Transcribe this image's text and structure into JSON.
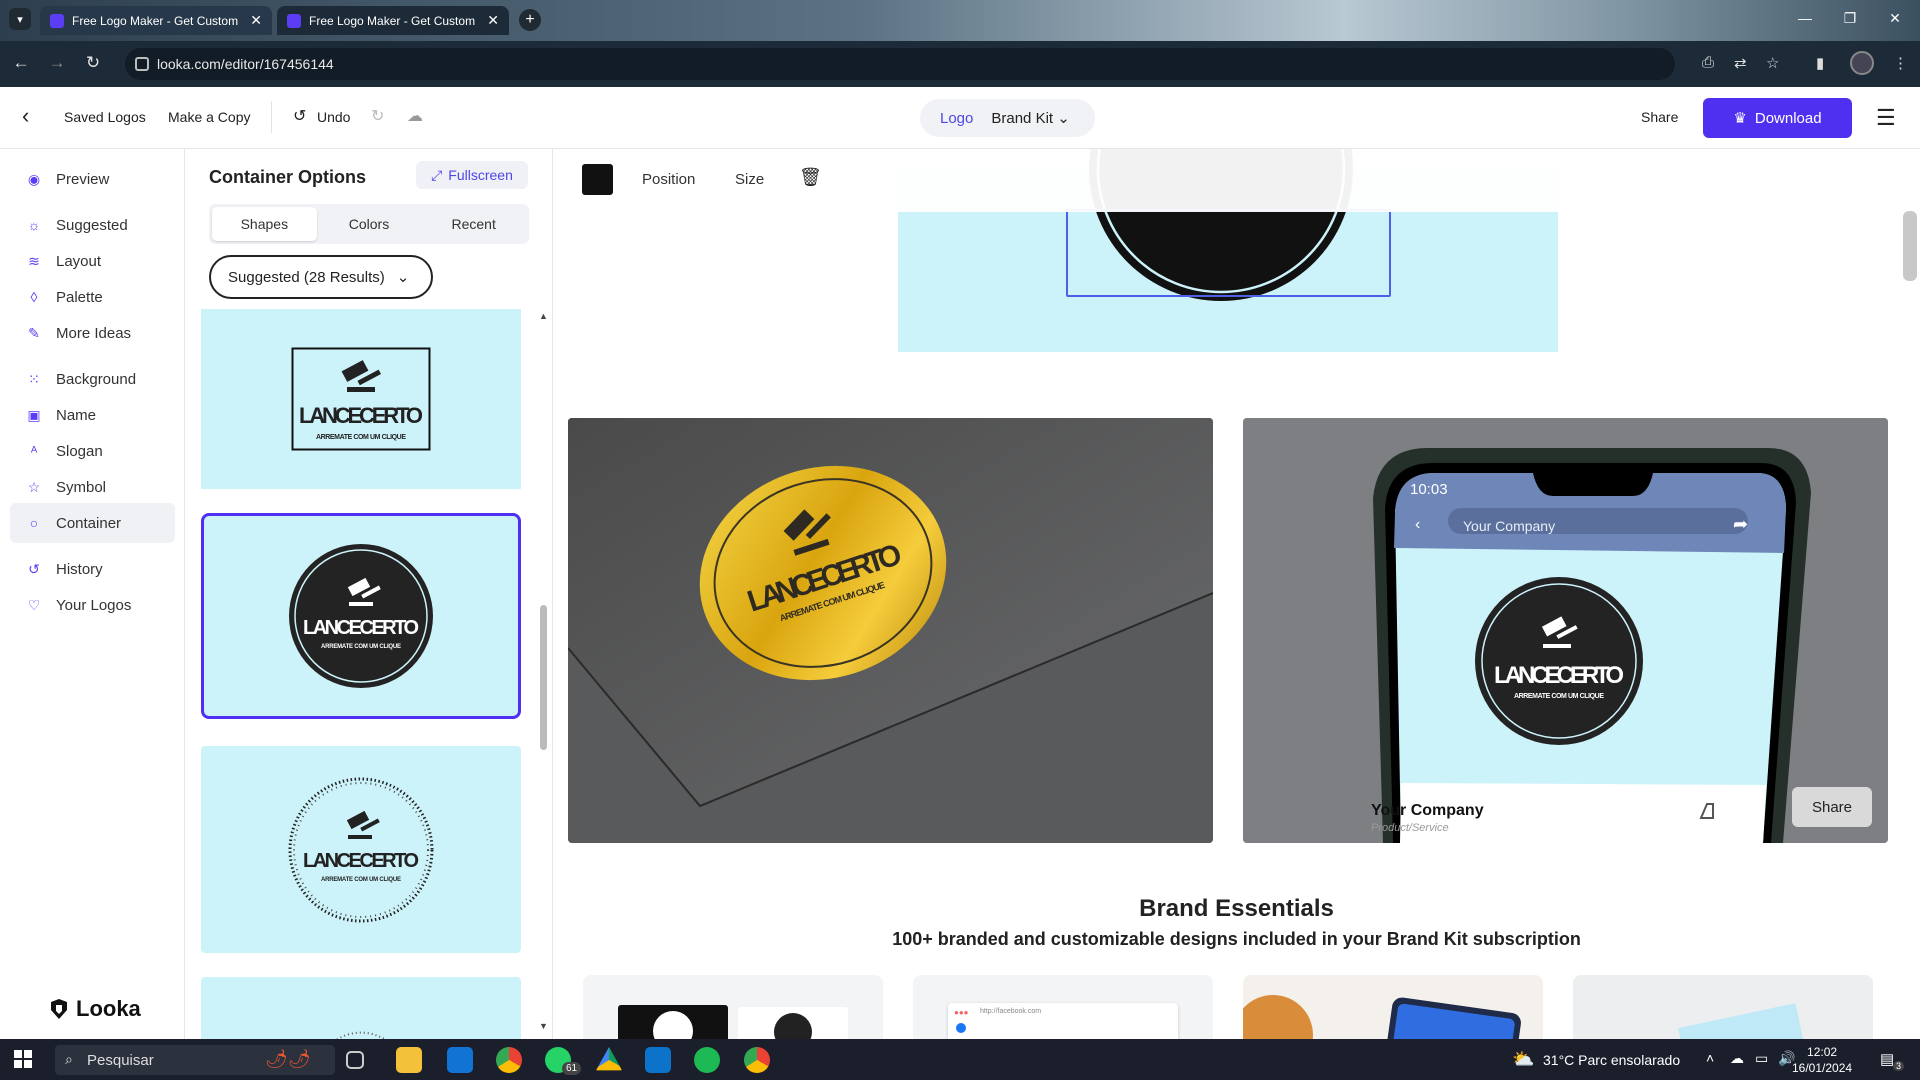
{
  "browser": {
    "tabs": [
      {
        "title": "Free Logo Maker - Get Custom"
      },
      {
        "title": "Free Logo Maker - Get Custom"
      }
    ],
    "url": "looka.com/editor/167456144"
  },
  "header": {
    "saved_logos": "Saved Logos",
    "make_copy": "Make a Copy",
    "undo": "Undo",
    "mode_logo": "Logo",
    "mode_brandkit": "Brand Kit",
    "share": "Share",
    "download": "Download"
  },
  "sidebar": {
    "items": [
      {
        "label": "Preview"
      },
      {
        "label": "Suggested"
      },
      {
        "label": "Layout"
      },
      {
        "label": "Palette"
      },
      {
        "label": "More Ideas"
      },
      {
        "label": "Background"
      },
      {
        "label": "Name"
      },
      {
        "label": "Slogan"
      },
      {
        "label": "Symbol"
      },
      {
        "label": "Container"
      },
      {
        "label": "History"
      },
      {
        "label": "Your Logos"
      }
    ],
    "brand": "Looka"
  },
  "options": {
    "title": "Container Options",
    "fullscreen": "Fullscreen",
    "tabs": [
      "Shapes",
      "Colors",
      "Recent"
    ],
    "dropdown": "Suggested (28 Results)",
    "logo_name": "LANCECERTO",
    "logo_slogan": "ARREMATE COM UM CLIQUE"
  },
  "toolbar": {
    "position": "Position",
    "size": "Size",
    "swatch_color": "#111111"
  },
  "mockups": {
    "phone_time": "10:03",
    "phone_search": "Your Company",
    "company": "Your Company",
    "subtitle": "Product/Service",
    "share": "Share"
  },
  "essentials": {
    "title": "Brand Essentials",
    "subtitle": "100+ branded and customizable designs included in your Brand Kit subscription",
    "browser_url": "http://facebook.com"
  },
  "taskbar": {
    "search": "Pesquisar",
    "weather": "31°C  Parc ensolarado",
    "time": "12:02",
    "date": "16/01/2024",
    "whatsapp_badge": "61",
    "notif_badge": "3"
  },
  "colors": {
    "accent": "#4f30f0",
    "logo_bg": "#cdf3fa"
  }
}
